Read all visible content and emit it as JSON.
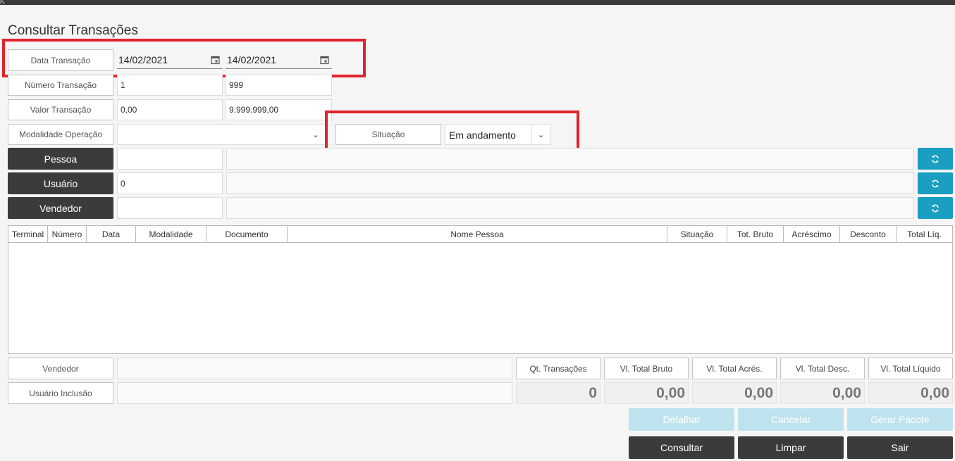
{
  "page": {
    "title": "Consultar Transações"
  },
  "filters": {
    "data_label": "Data Transação",
    "data_from": "14/02/2021",
    "data_to": "14/02/2021",
    "numero_label": "Número Transação",
    "numero_from": "1",
    "numero_to": "999",
    "valor_label": "Valor Transação",
    "valor_from": "0,00",
    "valor_to": "9.999.999,00",
    "modalidade_label": "Modalidade Operação",
    "modalidade_value": "",
    "situacao_label": "Situação",
    "situacao_value": "Em andamento",
    "pessoa_label": "Pessoa",
    "pessoa_code": "",
    "pessoa_name": "",
    "usuario_label": "Usuário",
    "usuario_code": "0",
    "usuario_name": "",
    "vendedor_label": "Vendedor",
    "vendedor_code": "",
    "vendedor_name": ""
  },
  "grid": {
    "columns": [
      "Terminal",
      "Número",
      "Data",
      "Modalidade",
      "Documento",
      "Nome Pessoa",
      "Situação",
      "Tot. Bruto",
      "Acréscimo",
      "Desconto",
      "Total Líq."
    ],
    "rows": []
  },
  "details": {
    "vendedor_label": "Vendedor",
    "vendedor_value": "",
    "usuario_inclusao_label": "Usuário Inclusão",
    "usuario_inclusao_value": ""
  },
  "summary": {
    "qt_transacoes_label": "Qt. Transações",
    "qt_transacoes_value": "0",
    "vl_total_bruto_label": "Vl. Total Bruto",
    "vl_total_bruto_value": "0,00",
    "vl_total_acres_label": "Vl. Total Acrés.",
    "vl_total_acres_value": "0,00",
    "vl_total_desc_label": "Vl. Total Desc.",
    "vl_total_desc_value": "0,00",
    "vl_total_liquido_label": "Vl. Total Líquido",
    "vl_total_liquido_value": "0,00"
  },
  "actions": {
    "detalhar": "Detalhar",
    "cancelar": "Cancelar",
    "gerar_pacote": "Gerar Pacote",
    "consultar": "Consultar",
    "limpar": "Limpar",
    "sair": "Sair"
  },
  "colors": {
    "highlight": "#e0242c",
    "accent": "#1a9ec1",
    "dark_button": "#3b3b3b",
    "disabled_button": "#bfe3ee"
  },
  "icons": {
    "calendar": "calendar-icon",
    "refresh": "refresh-icon",
    "chevron": "chevron-down-icon"
  }
}
